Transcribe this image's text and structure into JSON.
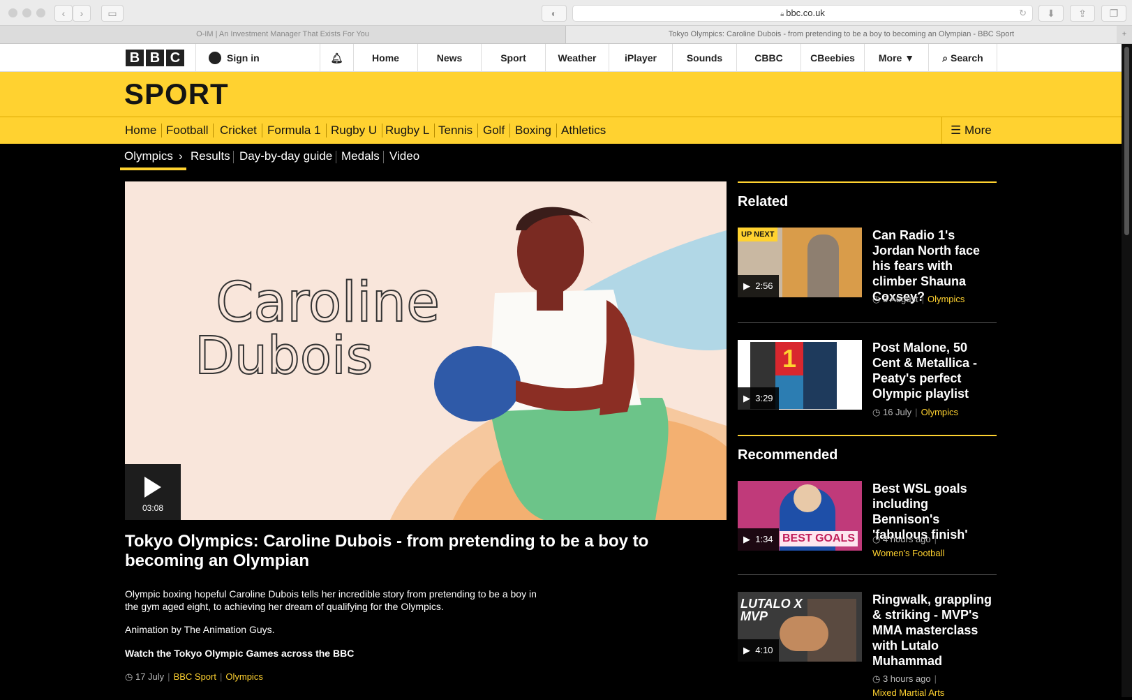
{
  "browser": {
    "url": "bbc.co.uk",
    "tabs": [
      {
        "label": "O-IM | An Investment Manager That Exists For You"
      },
      {
        "label": "Tokyo Olympics: Caroline Dubois - from pretending to be a boy to becoming an Olympian - BBC Sport"
      }
    ]
  },
  "global_nav": {
    "logo": [
      "B",
      "B",
      "C"
    ],
    "sign_in": "Sign in",
    "items": [
      "Home",
      "News",
      "Sport",
      "Weather",
      "iPlayer",
      "Sounds",
      "CBBC",
      "CBeebies"
    ],
    "more": "More",
    "search": "Search"
  },
  "sport": {
    "title": "SPORT",
    "nav": [
      "Home",
      "Football",
      "Cricket",
      "Formula 1",
      "Rugby U",
      "Rugby L",
      "Tennis",
      "Golf",
      "Boxing",
      "Athletics"
    ],
    "nav_more": "More",
    "subnav": [
      "Olympics",
      "Results",
      "Day-by-day guide",
      "Medals",
      "Video"
    ]
  },
  "main": {
    "video_text_line1": "Caroline",
    "video_text_line2": "Dubois",
    "duration": "03:08",
    "headline": "Tokyo Olympics: Caroline Dubois - from pretending to be a boy to becoming an Olympian",
    "summary": "Olympic boxing hopeful Caroline Dubois tells her incredible story from pretending to be a boy in the gym aged eight, to achieving her dream of qualifying for the Olympics.",
    "credit": "Animation by The Animation Guys.",
    "watch": "Watch the Tokyo Olympic Games across the BBC",
    "date": "17 July",
    "source": "BBC Sport",
    "tag": "Olympics"
  },
  "related": {
    "heading": "Related",
    "items": [
      {
        "badge": "UP NEXT",
        "duration": "2:56",
        "title": "Can Radio 1's Jordan North face his fears with climber Shauna Coxsey?",
        "date": "3 August",
        "tag": "Olympics"
      },
      {
        "duration": "3:29",
        "title": "Post Malone, 50 Cent & Metallica - Peaty's perfect Olympic playlist",
        "date": "16 July",
        "tag": "Olympics"
      }
    ]
  },
  "recommended": {
    "heading": "Recommended",
    "items": [
      {
        "duration": "1:34",
        "title": "Best WSL goals including Bennison's 'fabulous finish'",
        "date": "4 hours ago",
        "tag": "Women's Football",
        "thumb_text": "BEST GOALS"
      },
      {
        "duration": "4:10",
        "title": "Ringwalk, grappling & striking - MVP's MMA masterclass with Lutalo Muhammad",
        "date": "3 hours ago",
        "tag": "Mixed Martial Arts",
        "thumb_text": "LUTALO X MVP"
      }
    ]
  },
  "colors": {
    "accent": "#ffd230",
    "background": "#000000"
  }
}
